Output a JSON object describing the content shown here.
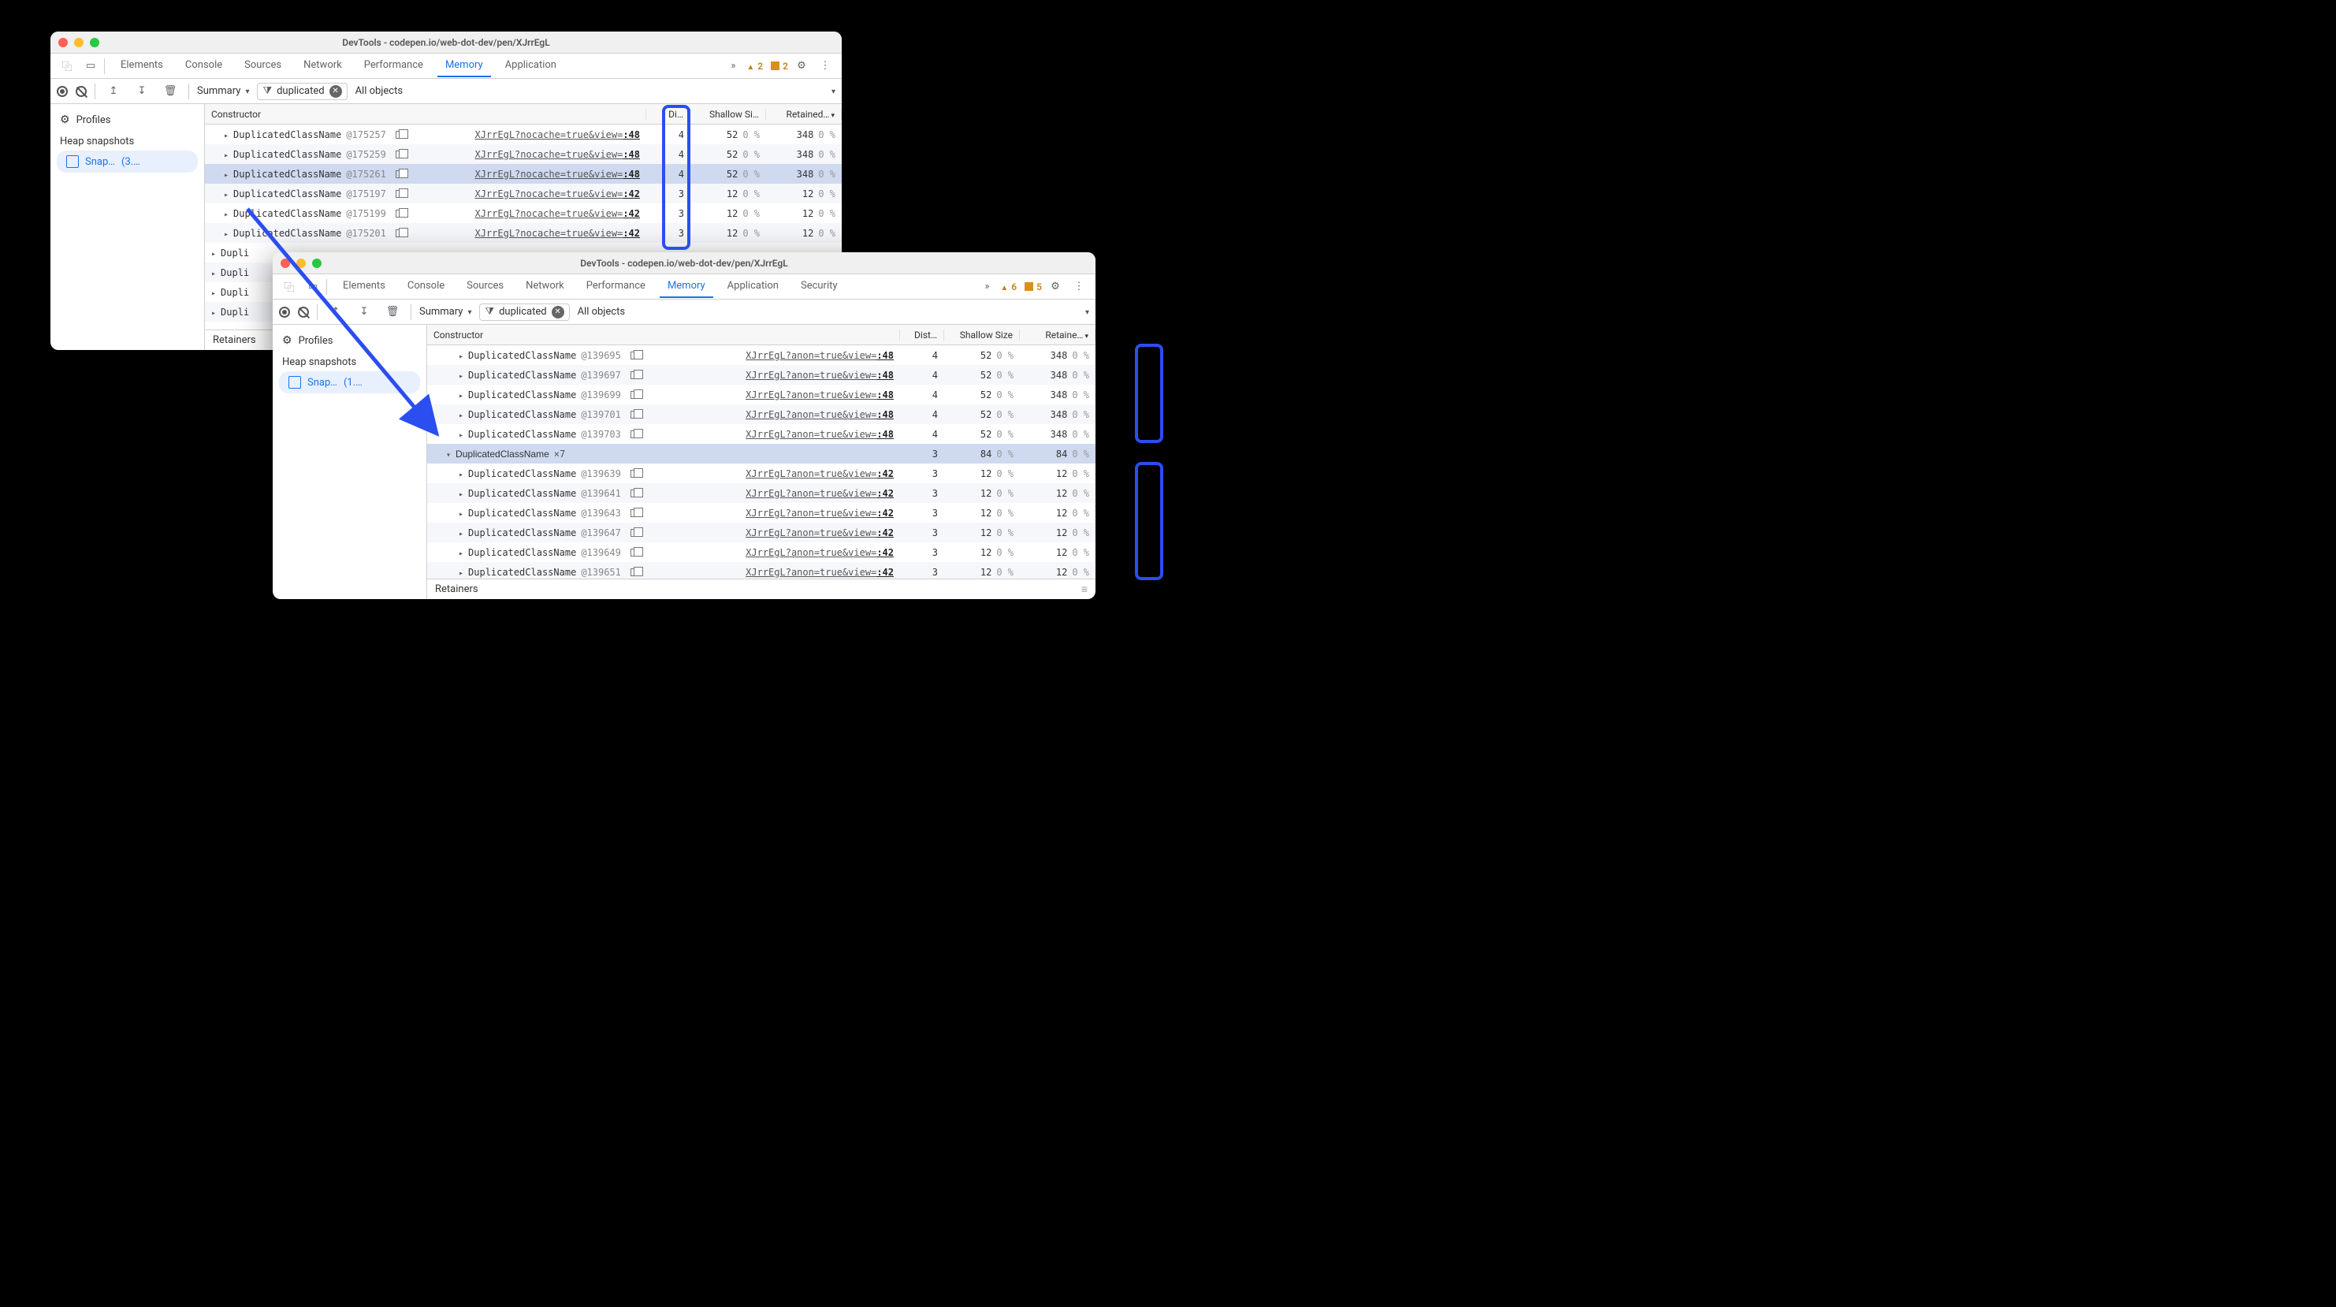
{
  "windowA": {
    "title": "DevTools - codepen.io/web-dot-dev/pen/XJrrEgL",
    "warnings": 2,
    "issues": 2,
    "tabs": [
      "Elements",
      "Console",
      "Sources",
      "Network",
      "Performance",
      "Memory",
      "Application"
    ],
    "activeTab": "Memory",
    "summary_label": "Summary",
    "filter_value": "duplicated",
    "objects_filter": "All objects",
    "sidebar": {
      "profiles_label": "Profiles",
      "heap_label": "Heap snapshots",
      "item_label": "Snap…",
      "item_size": "(3.…"
    },
    "columns": {
      "constructor": "Constructor",
      "distance": "Di…",
      "shallow": "Shallow Si…",
      "retained": "Retained…"
    },
    "rows": [
      {
        "name": "DuplicatedClassName",
        "oid": "@175257",
        "link": "XJrrEgL?nocache=true&view=",
        "tail": ":48",
        "dist": 4,
        "ss": 52,
        "ssp": "0 %",
        "rs": 348,
        "rsp": "0 %",
        "indent": 1
      },
      {
        "name": "DuplicatedClassName",
        "oid": "@175259",
        "link": "XJrrEgL?nocache=true&view=",
        "tail": ":48",
        "dist": 4,
        "ss": 52,
        "ssp": "0 %",
        "rs": 348,
        "rsp": "0 %",
        "indent": 1
      },
      {
        "name": "DuplicatedClassName",
        "oid": "@175261",
        "link": "XJrrEgL?nocache=true&view=",
        "tail": ":48",
        "dist": 4,
        "ss": 52,
        "ssp": "0 %",
        "rs": 348,
        "rsp": "0 %",
        "indent": 1,
        "sel": true
      },
      {
        "name": "DuplicatedClassName",
        "oid": "@175197",
        "link": "XJrrEgL?nocache=true&view=",
        "tail": ":42",
        "dist": 3,
        "ss": 12,
        "ssp": "0 %",
        "rs": 12,
        "rsp": "0 %",
        "indent": 1
      },
      {
        "name": "DuplicatedClassName",
        "oid": "@175199",
        "link": "XJrrEgL?nocache=true&view=",
        "tail": ":42",
        "dist": 3,
        "ss": 12,
        "ssp": "0 %",
        "rs": 12,
        "rsp": "0 %",
        "indent": 1
      },
      {
        "name": "DuplicatedClassName",
        "oid": "@175201",
        "link": "XJrrEgL?nocache=true&view=",
        "tail": ":42",
        "dist": 3,
        "ss": 12,
        "ssp": "0 %",
        "rs": 12,
        "rsp": "0 %",
        "indent": 1
      },
      {
        "name": "Dupli",
        "indent": 0,
        "trunc": true
      },
      {
        "name": "Dupli",
        "indent": 0,
        "trunc": true
      },
      {
        "name": "Dupli",
        "indent": 0,
        "trunc": true
      },
      {
        "name": "Dupli",
        "indent": 0,
        "trunc": true
      }
    ],
    "retainers": "Retainers"
  },
  "windowB": {
    "title": "DevTools - codepen.io/web-dot-dev/pen/XJrrEgL",
    "warnings": 6,
    "issues": 5,
    "tabs": [
      "Elements",
      "Console",
      "Sources",
      "Network",
      "Performance",
      "Memory",
      "Application",
      "Security"
    ],
    "activeTab": "Memory",
    "summary_label": "Summary",
    "filter_value": "duplicated",
    "objects_filter": "All objects",
    "sidebar": {
      "profiles_label": "Profiles",
      "heap_label": "Heap snapshots",
      "item_label": "Snap…",
      "item_size": "(1.…"
    },
    "columns": {
      "constructor": "Constructor",
      "distance": "Dist…",
      "shallow": "Shallow Size",
      "retained": "Retaine…"
    },
    "rows": [
      {
        "name": "DuplicatedClassName",
        "oid": "@139695",
        "link": "XJrrEgL?anon=true&view=",
        "tail": ":48",
        "dist": 4,
        "ss": 52,
        "ssp": "0 %",
        "rs": 348,
        "rsp": "0 %",
        "indent": 2
      },
      {
        "name": "DuplicatedClassName",
        "oid": "@139697",
        "link": "XJrrEgL?anon=true&view=",
        "tail": ":48",
        "dist": 4,
        "ss": 52,
        "ssp": "0 %",
        "rs": 348,
        "rsp": "0 %",
        "indent": 2
      },
      {
        "name": "DuplicatedClassName",
        "oid": "@139699",
        "link": "XJrrEgL?anon=true&view=",
        "tail": ":48",
        "dist": 4,
        "ss": 52,
        "ssp": "0 %",
        "rs": 348,
        "rsp": "0 %",
        "indent": 2
      },
      {
        "name": "DuplicatedClassName",
        "oid": "@139701",
        "link": "XJrrEgL?anon=true&view=",
        "tail": ":48",
        "dist": 4,
        "ss": 52,
        "ssp": "0 %",
        "rs": 348,
        "rsp": "0 %",
        "indent": 2
      },
      {
        "name": "DuplicatedClassName",
        "oid": "@139703",
        "link": "XJrrEgL?anon=true&view=",
        "tail": ":48",
        "dist": 4,
        "ss": 52,
        "ssp": "0 %",
        "rs": 348,
        "rsp": "0 %",
        "indent": 2
      },
      {
        "name": "DuplicatedClassName",
        "x7": "×7",
        "dist": 3,
        "ss": 84,
        "ssp": "0 %",
        "rs": 84,
        "rsp": "0 %",
        "indent": 1,
        "open": true,
        "sel": true,
        "group": true
      },
      {
        "name": "DuplicatedClassName",
        "oid": "@139639",
        "link": "XJrrEgL?anon=true&view=",
        "tail": ":42",
        "dist": 3,
        "ss": 12,
        "ssp": "0 %",
        "rs": 12,
        "rsp": "0 %",
        "indent": 2
      },
      {
        "name": "DuplicatedClassName",
        "oid": "@139641",
        "link": "XJrrEgL?anon=true&view=",
        "tail": ":42",
        "dist": 3,
        "ss": 12,
        "ssp": "0 %",
        "rs": 12,
        "rsp": "0 %",
        "indent": 2
      },
      {
        "name": "DuplicatedClassName",
        "oid": "@139643",
        "link": "XJrrEgL?anon=true&view=",
        "tail": ":42",
        "dist": 3,
        "ss": 12,
        "ssp": "0 %",
        "rs": 12,
        "rsp": "0 %",
        "indent": 2
      },
      {
        "name": "DuplicatedClassName",
        "oid": "@139647",
        "link": "XJrrEgL?anon=true&view=",
        "tail": ":42",
        "dist": 3,
        "ss": 12,
        "ssp": "0 %",
        "rs": 12,
        "rsp": "0 %",
        "indent": 2
      },
      {
        "name": "DuplicatedClassName",
        "oid": "@139649",
        "link": "XJrrEgL?anon=true&view=",
        "tail": ":42",
        "dist": 3,
        "ss": 12,
        "ssp": "0 %",
        "rs": 12,
        "rsp": "0 %",
        "indent": 2
      },
      {
        "name": "DuplicatedClassName",
        "oid": "@139651",
        "link": "XJrrEgL?anon=true&view=",
        "tail": ":42",
        "dist": 3,
        "ss": 12,
        "ssp": "0 %",
        "rs": 12,
        "rsp": "0 %",
        "indent": 2
      }
    ],
    "retainers": "Retainers"
  }
}
